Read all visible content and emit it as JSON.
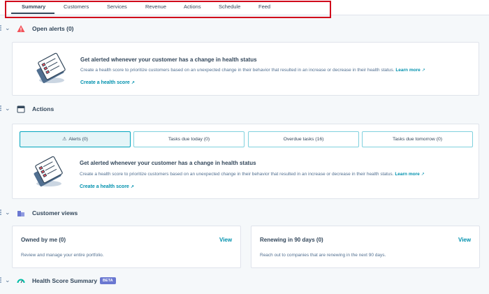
{
  "tabs": [
    {
      "label": "Summary",
      "active": true
    },
    {
      "label": "Customers"
    },
    {
      "label": "Services"
    },
    {
      "label": "Revenue"
    },
    {
      "label": "Actions"
    },
    {
      "label": "Schedule"
    },
    {
      "label": "Feed"
    }
  ],
  "sections": {
    "open_alerts": {
      "title": "Open alerts (0)"
    },
    "actions": {
      "title": "Actions"
    },
    "customer_views": {
      "title": "Customer views"
    },
    "health_score": {
      "title": "Health Score Summary",
      "badge": "BETA"
    }
  },
  "promo": {
    "title": "Get alerted whenever your customer has a change in health status",
    "text": "Create a health score to prioritize customers based on an unexpected change in their behavior that resulted in an increase or decrease in their health status.",
    "learn_more": "Learn more",
    "create_link": "Create a health score"
  },
  "action_buttons": [
    {
      "label": "Alerts (0)",
      "active": true
    },
    {
      "label": "Tasks due today (0)"
    },
    {
      "label": "Overdue tasks (16)"
    },
    {
      "label": "Tasks due tomorrow (0)"
    }
  ],
  "customer_views": [
    {
      "title": "Owned by me (0)",
      "link": "View",
      "desc": "Review and manage your entire portfolio."
    },
    {
      "title": "Renewing in 90 days (0)",
      "link": "View",
      "desc": "Reach out to companies that are renewing in the next 90 days."
    }
  ],
  "colors": {
    "accent": "#0091ae",
    "alert_red": "#f2545b",
    "highlight_box": "#d0021b",
    "beta": "#6a78d1"
  }
}
